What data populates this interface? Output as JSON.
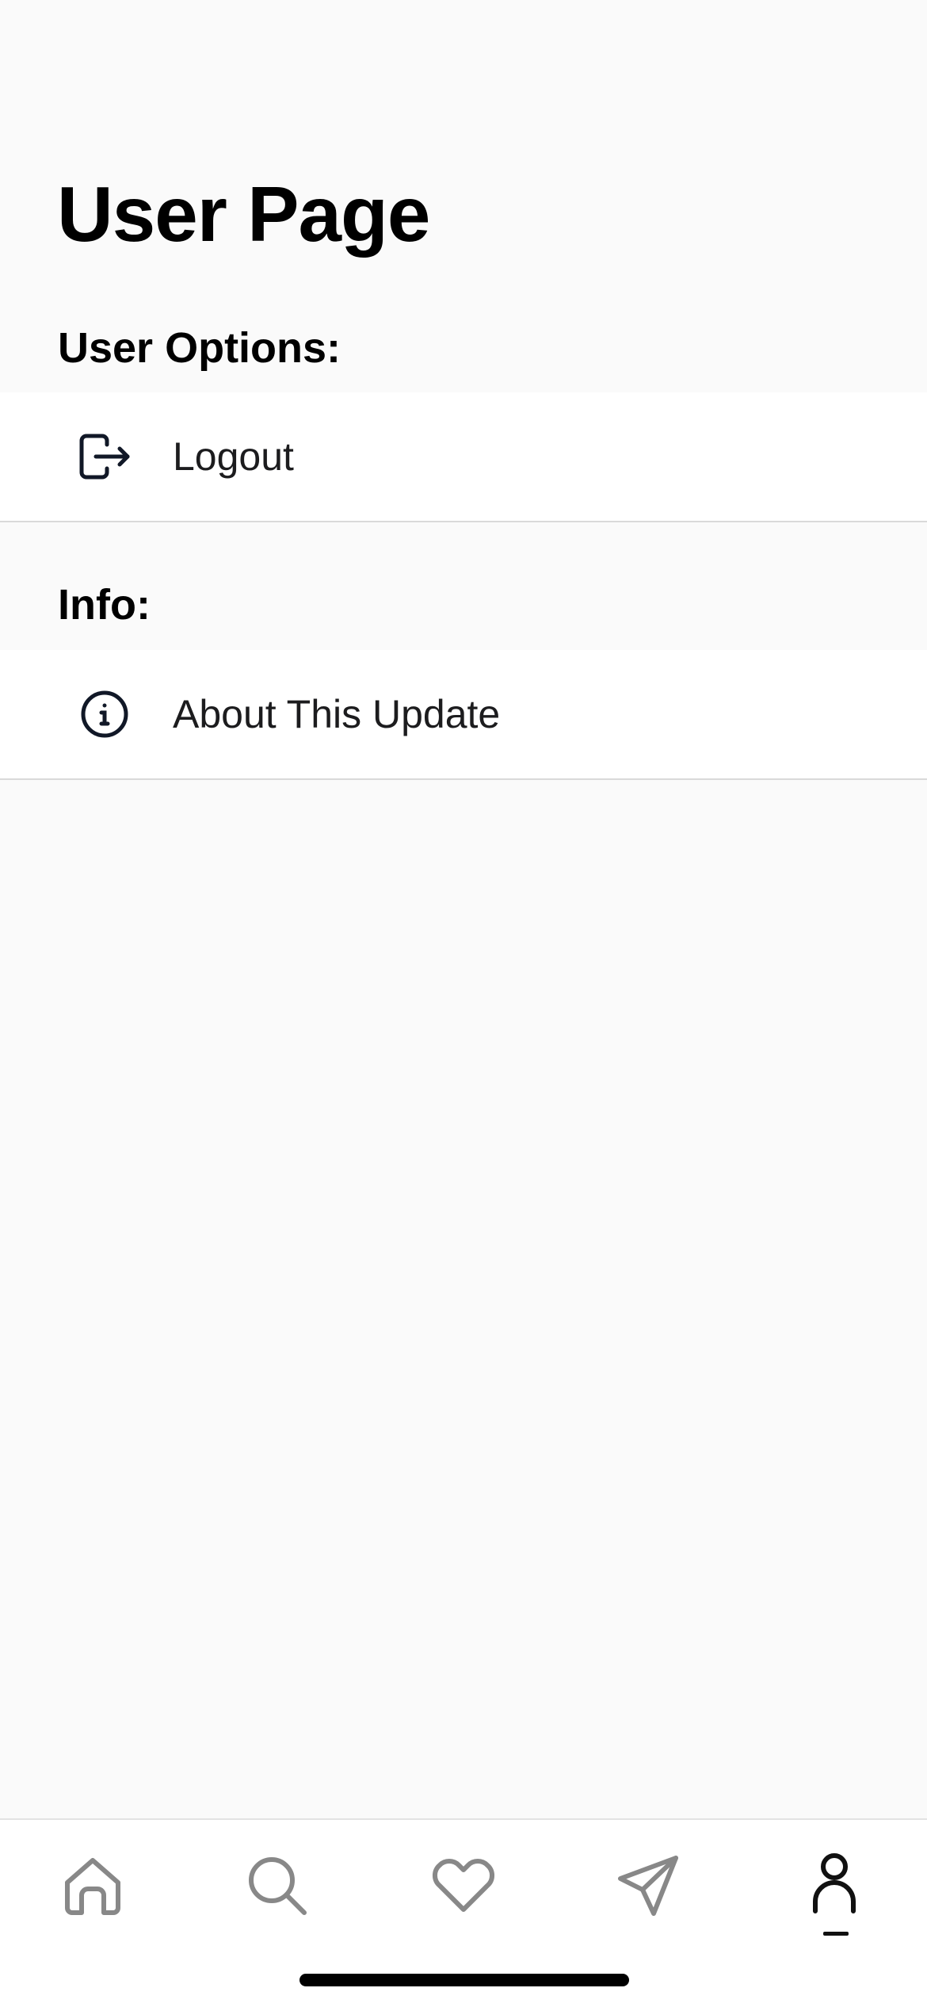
{
  "header": {
    "title": "User Page"
  },
  "sections": {
    "user_options": {
      "title": "User Options:",
      "logout": {
        "label": "Logout",
        "icon": "logout-icon"
      }
    },
    "info": {
      "title": "Info:",
      "about": {
        "label": "About This Update",
        "icon": "info-icon"
      }
    }
  },
  "tabbar": {
    "tabs": [
      {
        "name": "home",
        "icon": "home-icon",
        "active": false
      },
      {
        "name": "search",
        "icon": "search-icon",
        "active": false
      },
      {
        "name": "favorites",
        "icon": "heart-icon",
        "active": false
      },
      {
        "name": "send",
        "icon": "send-icon",
        "active": false
      },
      {
        "name": "profile",
        "icon": "user-icon",
        "active": true
      }
    ]
  },
  "colors": {
    "background": "#fafafa",
    "row_background": "#ffffff",
    "divider": "#d9d9d9",
    "inactive_tab_icon": "#888888",
    "active_tab_icon": "#111111"
  }
}
